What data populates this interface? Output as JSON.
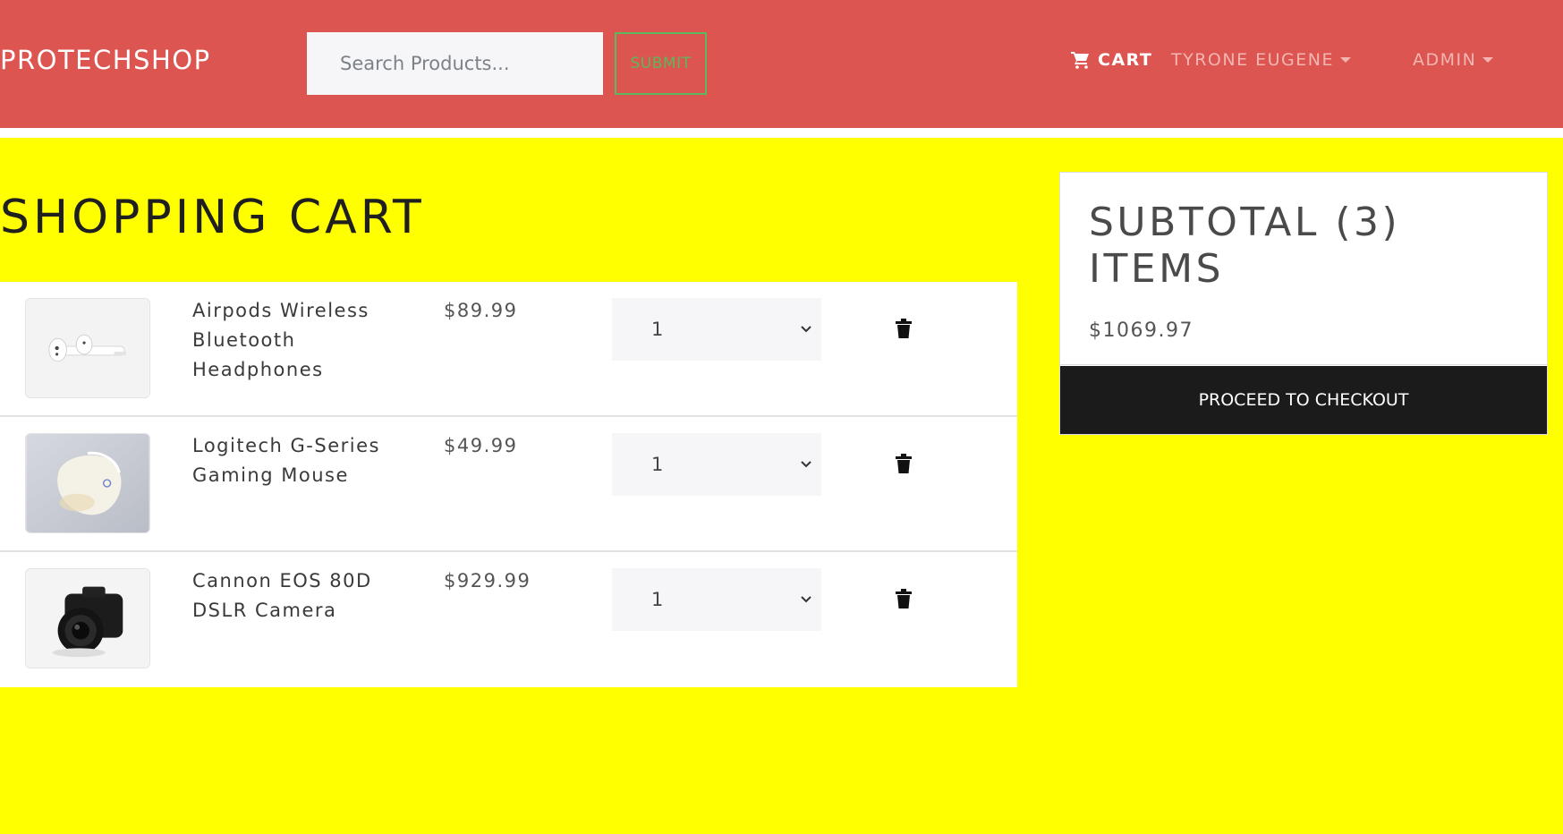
{
  "header": {
    "brand": "PROTECHSHOP",
    "search_placeholder": "Search Products...",
    "submit_label": "SUBMIT",
    "cart_label": "CART",
    "user_label": "TYRONE EUGENE",
    "admin_label": "ADMIN"
  },
  "main": {
    "title": "SHOPPING CART"
  },
  "cart": {
    "items": [
      {
        "name": "Airpods Wireless Bluetooth Headphones",
        "price": "$89.99",
        "qty": "1",
        "image_icon": "airpods-image"
      },
      {
        "name": "Logitech G-Series Gaming Mouse",
        "price": "$49.99",
        "qty": "1",
        "image_icon": "mouse-image"
      },
      {
        "name": "Cannon EOS 80D DSLR Camera",
        "price": "$929.99",
        "qty": "1",
        "image_icon": "camera-image"
      }
    ]
  },
  "summary": {
    "title": "SUBTOTAL (3) ITEMS",
    "total": "$1069.97",
    "checkout_label": "PROCEED TO CHECKOUT"
  },
  "colors": {
    "header_bg": "#dc5550",
    "page_bg": "#ffff00",
    "submit_green": "#5cb85c",
    "checkout_bg": "#1b1b1b"
  }
}
